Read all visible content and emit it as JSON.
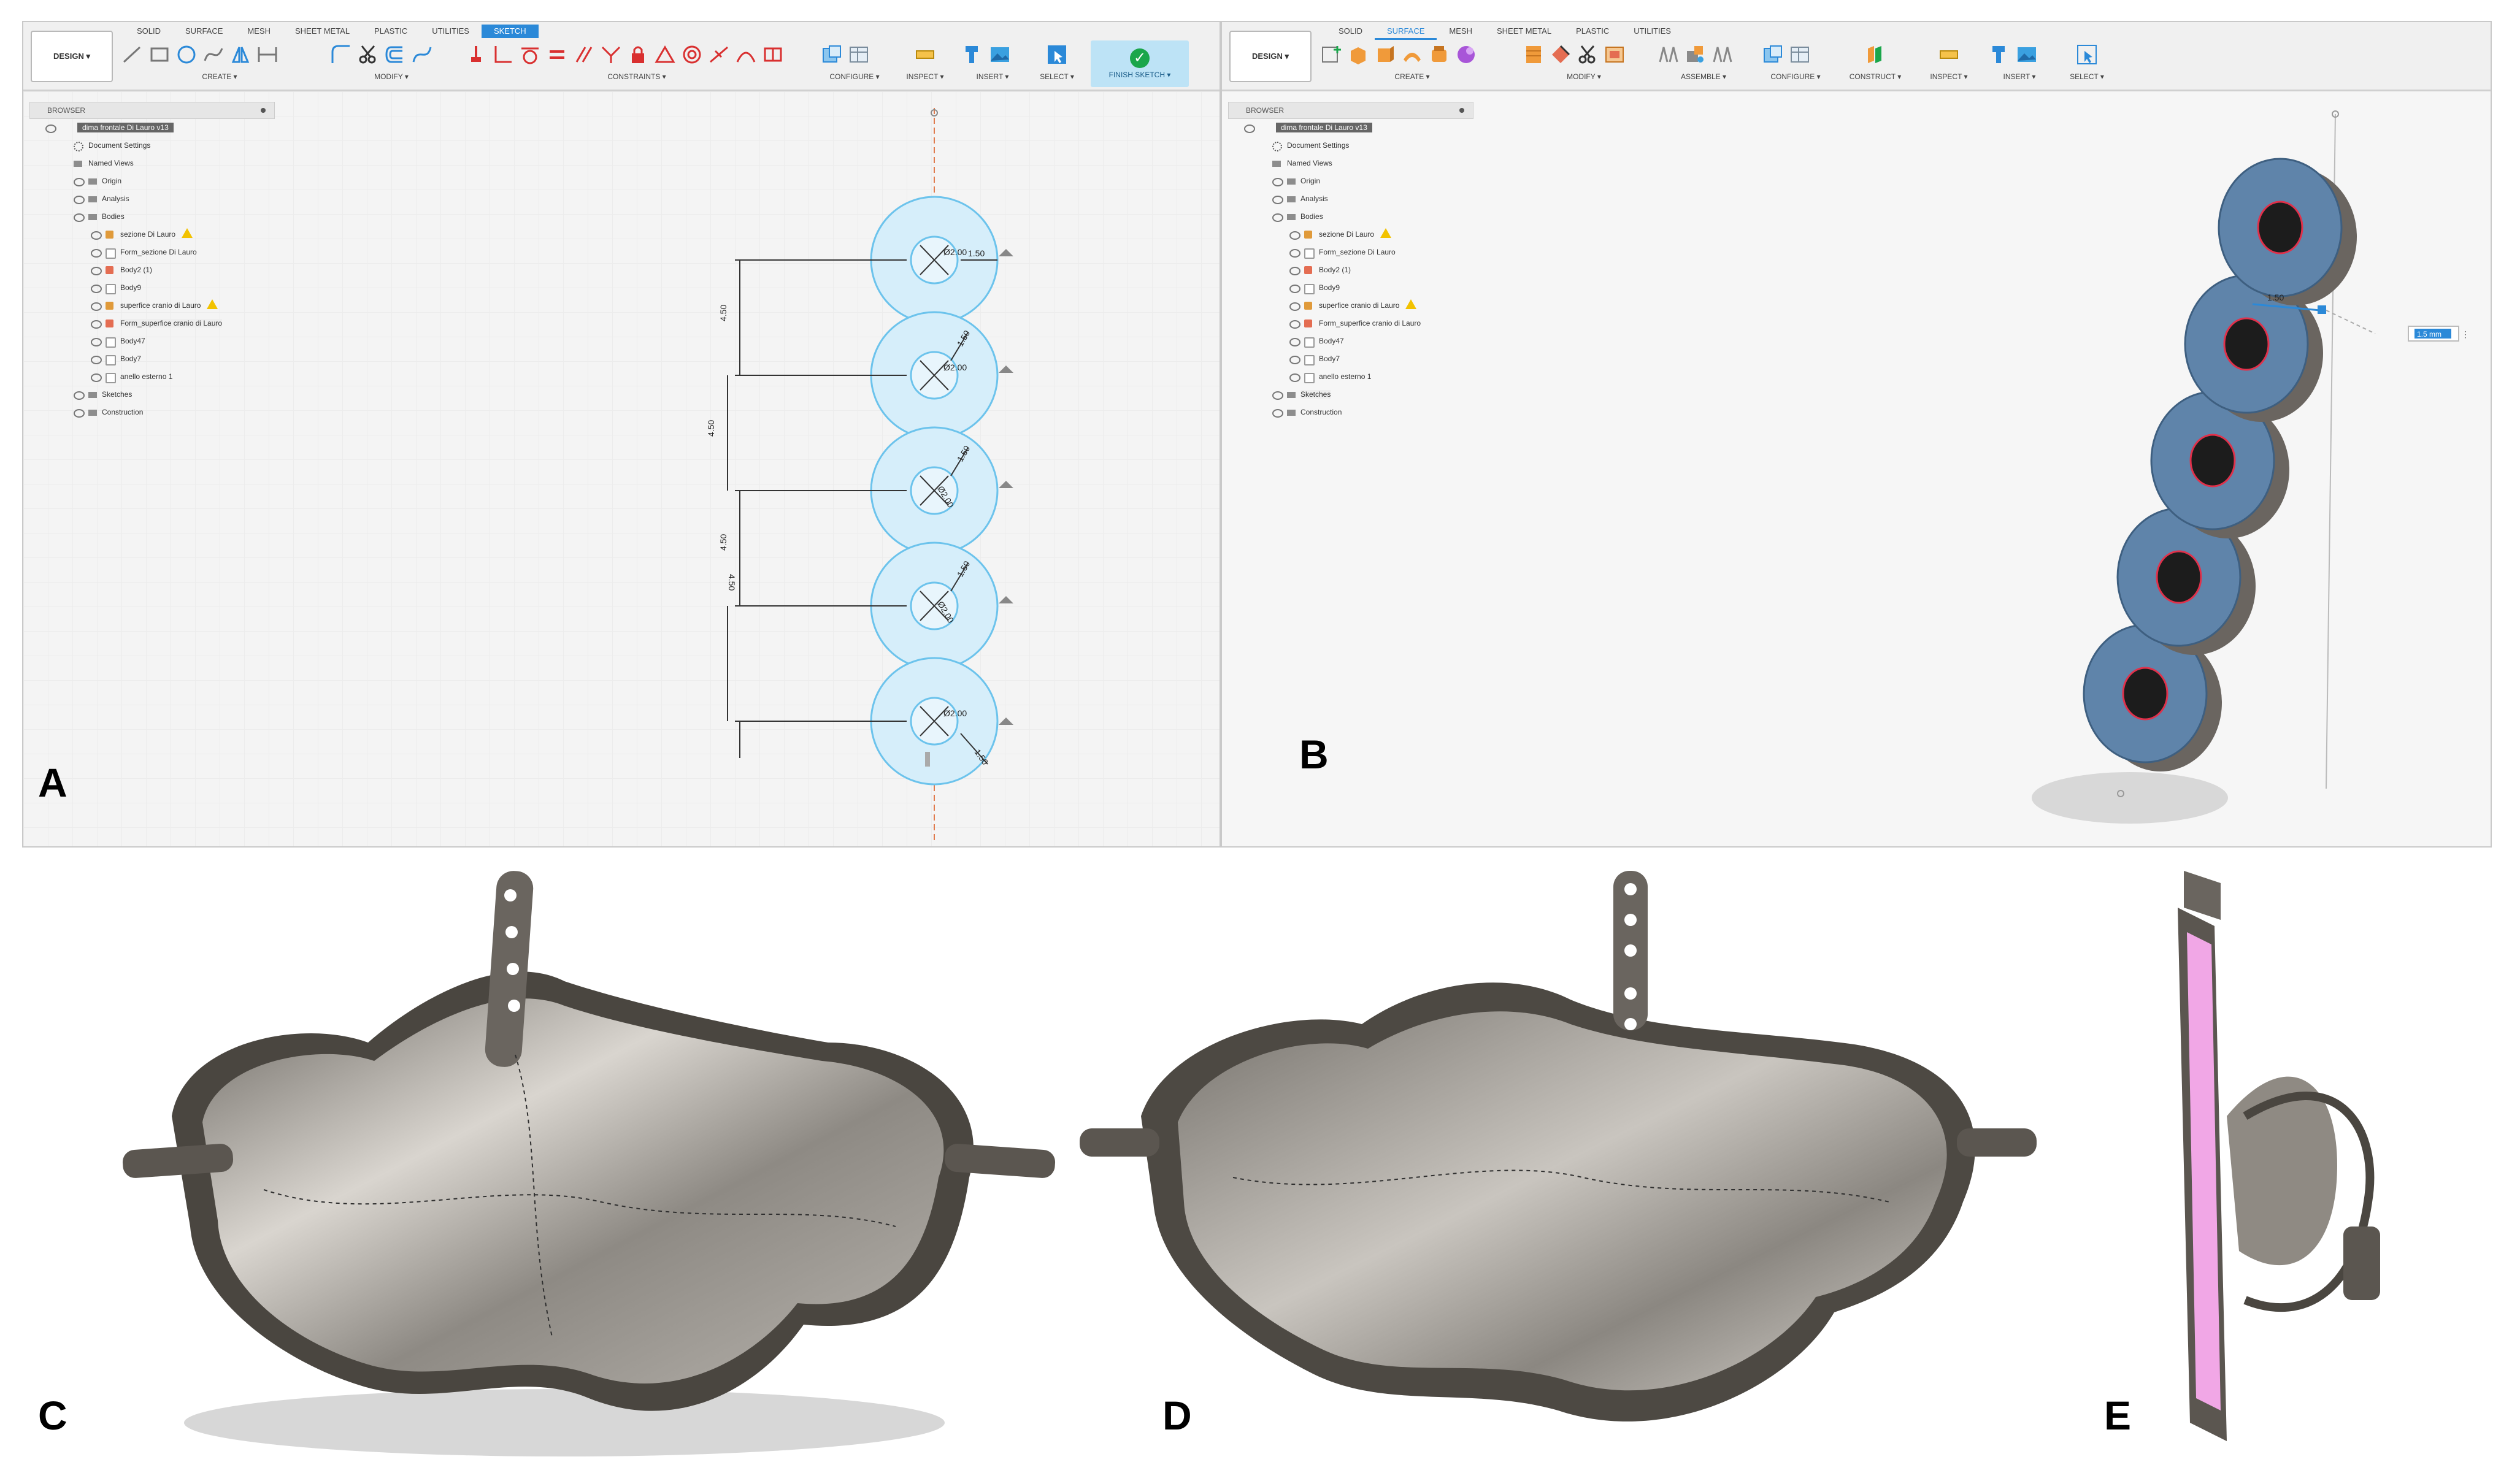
{
  "panel_letters": {
    "a": "A",
    "b": "B",
    "c": "C",
    "d": "D",
    "e": "E"
  },
  "window_a": {
    "design_label": "DESIGN ▾",
    "tabs": [
      "SOLID",
      "SURFACE",
      "MESH",
      "SHEET METAL",
      "PLASTIC",
      "UTILITIES",
      "SKETCH"
    ],
    "active_tab": "SKETCH",
    "groups": {
      "create": "CREATE ▾",
      "modify": "MODIFY ▾",
      "constraints": "CONSTRAINTS ▾",
      "configure": "CONFIGURE ▾",
      "inspect": "INSPECT ▾",
      "insert": "INSERT ▾",
      "select": "SELECT ▾"
    },
    "finish_label": "FINISH SKETCH ▾",
    "browser_title": "BROWSER",
    "tree": {
      "root": "dima frontale Di Lauro v13",
      "document_settings": "Document Settings",
      "named_views": "Named Views",
      "origin": "Origin",
      "analysis": "Analysis",
      "bodies": "Bodies",
      "bodies_items": [
        "sezione Di Lauro",
        "Form_sezione Di Lauro",
        "Body2 (1)",
        "Body9",
        "superfice cranio di Lauro",
        "Form_superfice cranio di Lauro",
        "Body47",
        "Body7",
        "anello esterno 1"
      ],
      "sketches": "Sketches",
      "construction": "Construction"
    },
    "dimensions": {
      "diameter": "Ø2.00",
      "width": "1.50",
      "spacing": "4.50"
    }
  },
  "window_b": {
    "design_label": "DESIGN ▾",
    "tabs": [
      "SOLID",
      "SURFACE",
      "MESH",
      "SHEET METAL",
      "PLASTIC",
      "UTILITIES"
    ],
    "active_tab": "SURFACE",
    "groups": {
      "create": "CREATE ▾",
      "modify": "MODIFY ▾",
      "assemble": "ASSEMBLE ▾",
      "configure": "CONFIGURE ▾",
      "construct": "CONSTRUCT ▾",
      "inspect": "INSPECT ▾",
      "insert": "INSERT ▾",
      "select": "SELECT ▾"
    },
    "browser_title": "BROWSER",
    "tree": {
      "root": "dima frontale Di Lauro v13",
      "document_settings": "Document Settings",
      "named_views": "Named Views",
      "origin": "Origin",
      "analysis": "Analysis",
      "bodies": "Bodies",
      "bodies_items": [
        "sezione Di Lauro",
        "Form_sezione Di Lauro",
        "Body2 (1)",
        "Body9",
        "superfice cranio di Lauro",
        "Form_superfice cranio di Lauro",
        "Body47",
        "Body7",
        "anello esterno 1"
      ],
      "sketches": "Sketches",
      "construction": "Construction"
    },
    "dimension": "1.50",
    "input_value": "1.5 mm"
  },
  "colors": {
    "accent": "#2b89d8",
    "sketch_fill": "#d6eefa",
    "sketch_line": "#6cc3ec",
    "body_blue": "#5f84aa",
    "metal": "#8f8a83",
    "warning": "#f2c200",
    "pink": "#f1a7e6"
  },
  "icons": [
    "eye-icon",
    "folder-icon",
    "gear-icon",
    "body-icon",
    "warning-icon",
    "checkmark-icon"
  ]
}
